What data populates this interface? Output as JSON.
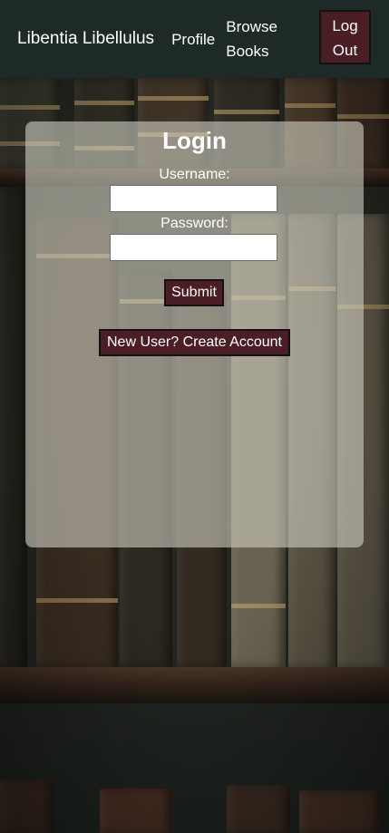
{
  "nav": {
    "brand": "Libentia Libellulus",
    "profile": "Profile",
    "browse": "Browse Books",
    "logout": "Log Out"
  },
  "login": {
    "title": "Login",
    "username_label": "Username:",
    "username_value": "",
    "password_label": "Password:",
    "password_value": "",
    "submit": "Submit",
    "create_account": "New User? Create Account"
  },
  "colors": {
    "nav_bg": "#1e2a27",
    "button_bg": "#4a1e24",
    "panel_bg": "rgba(205, 203, 190, 0.62)"
  }
}
